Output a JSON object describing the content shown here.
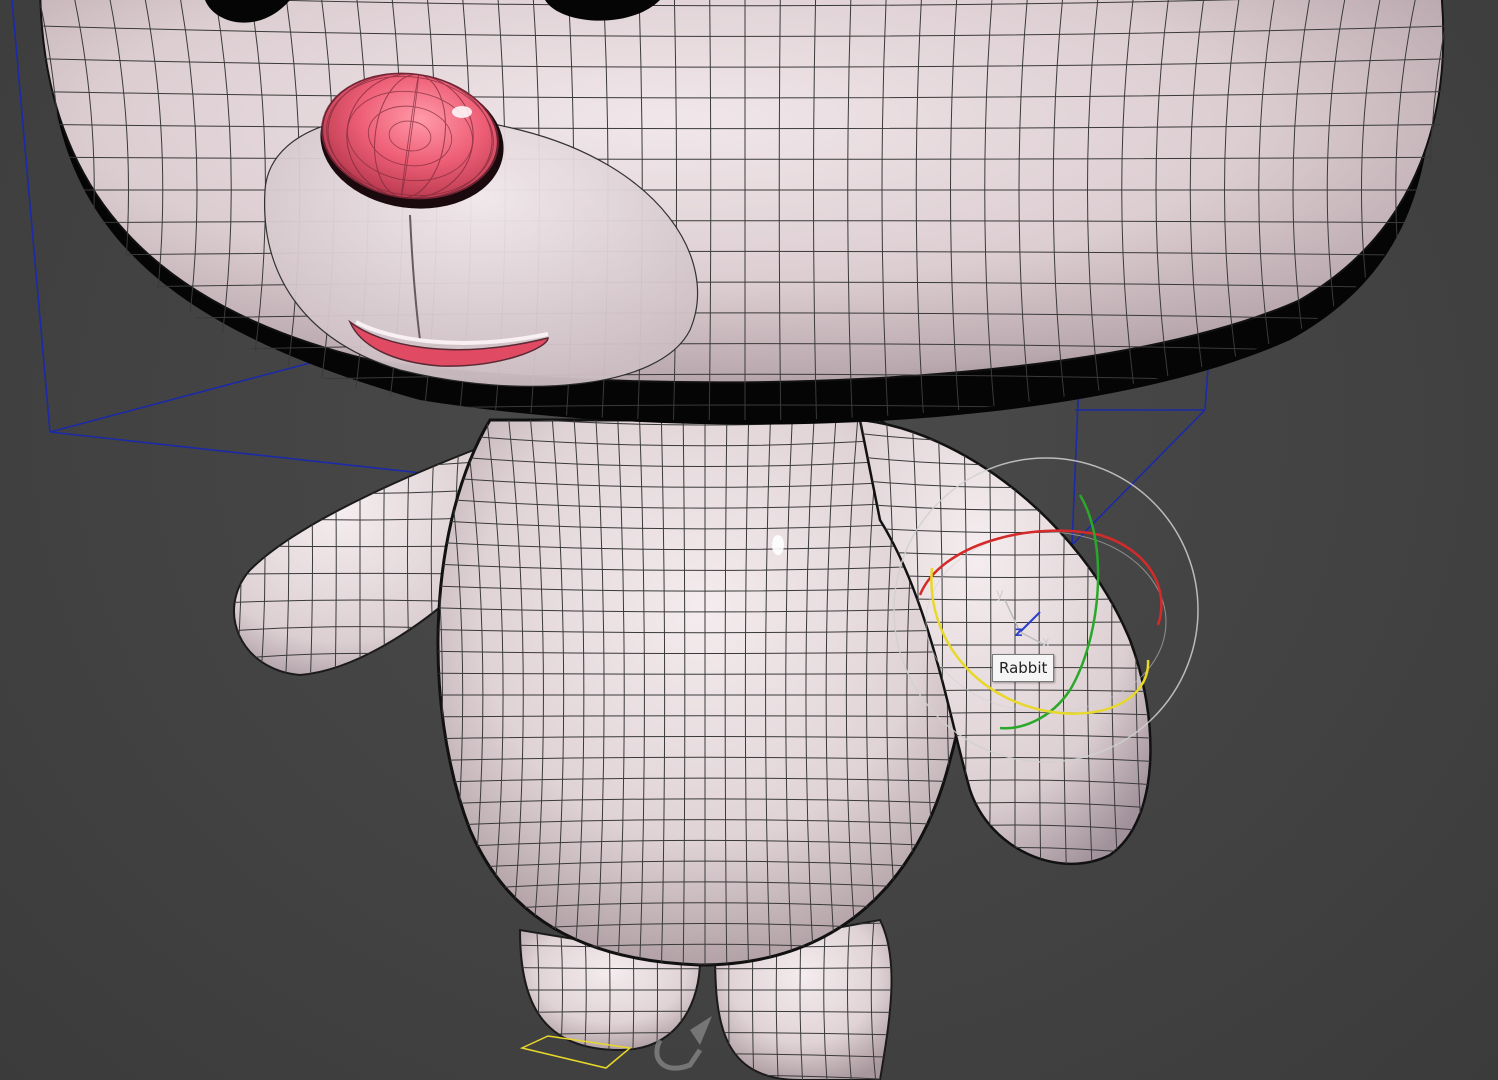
{
  "viewport": {
    "background": "#444444",
    "object_tooltip": "Rabbit"
  },
  "model": {
    "body_color": "#e9dde0",
    "wire_color": "#3a3a3a",
    "nose_color": "#f0607a",
    "shadow_color": "#050505"
  },
  "bounding_box": {
    "color": "#1a2aa8"
  },
  "gizmo": {
    "x_axis_label": "x",
    "y_axis_label": "y",
    "z_axis_label": "z",
    "x_ring_color": "#d42a2a",
    "y_ring_color": "#2aa82a",
    "z_ring_color": "#e8d82a",
    "screen_ring_color": "#d0d0d0"
  }
}
